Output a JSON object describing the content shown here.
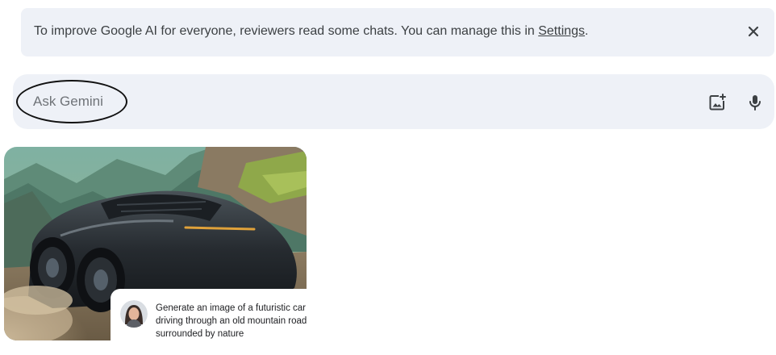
{
  "notice": {
    "text": "To improve Google AI for everyone, reviewers read some chats. You can manage this in ",
    "link_label": "Settings",
    "trailing": ".",
    "close_icon": "close-icon"
  },
  "input": {
    "placeholder": "Ask Gemini",
    "value": "",
    "icons": [
      "image-upload-icon",
      "microphone-icon"
    ]
  },
  "generated_image": {
    "subject": "futuristic car"
  },
  "prompt": {
    "text": "Generate an image of a futuristic car driving through an old mountain road surrounded by nature"
  },
  "colors": {
    "panel_bg": "#eef1f7",
    "text": "#3c4043"
  }
}
